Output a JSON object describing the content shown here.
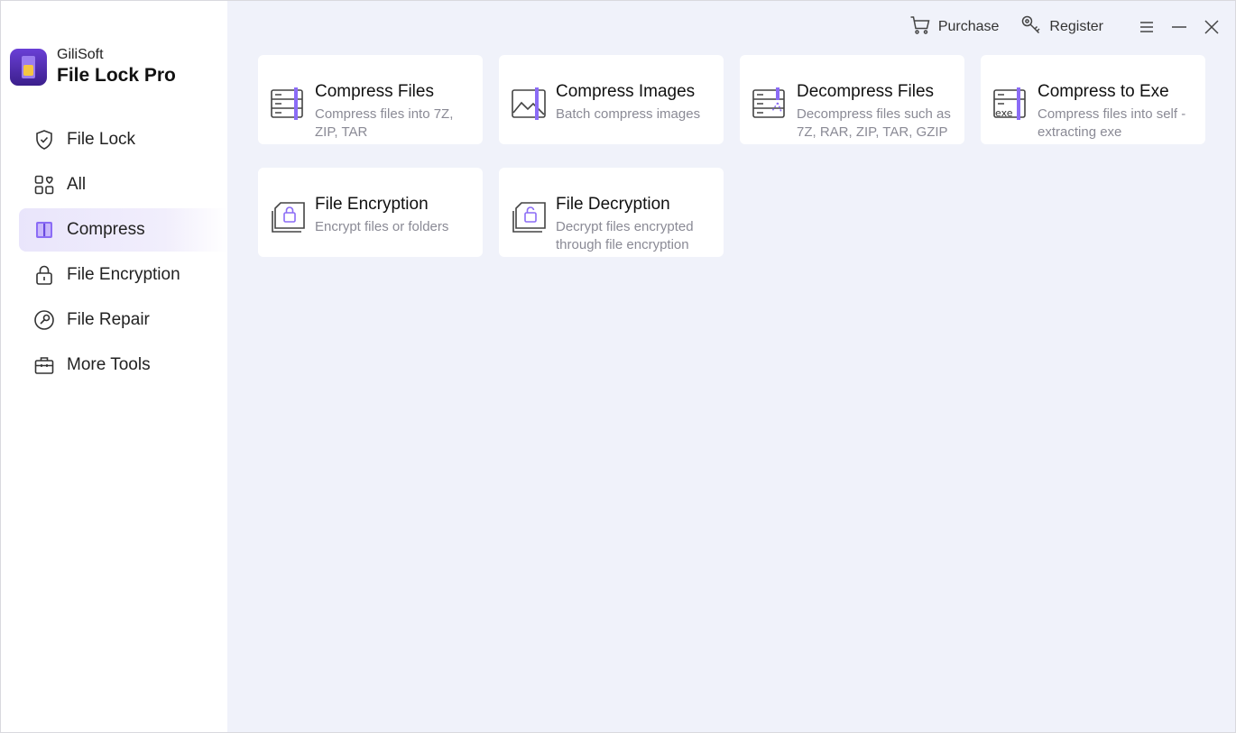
{
  "brand": {
    "company": "GiliSoft",
    "product": "File Lock Pro"
  },
  "sidebar": {
    "items": [
      {
        "label": "File Lock",
        "icon": "shield-check-icon",
        "active": false
      },
      {
        "label": "All",
        "icon": "grid-heart-icon",
        "active": false
      },
      {
        "label": "Compress",
        "icon": "zip-archive-icon",
        "active": true
      },
      {
        "label": "File Encryption",
        "icon": "padlock-icon",
        "active": false
      },
      {
        "label": "File Repair",
        "icon": "wrench-circle-icon",
        "active": false
      },
      {
        "label": "More Tools",
        "icon": "toolbox-icon",
        "active": false
      }
    ]
  },
  "topbar": {
    "purchase": "Purchase",
    "register": "Register"
  },
  "cards": [
    {
      "title": "Compress Files",
      "desc": "Compress files into 7Z, ZIP, TAR",
      "icon": "compress-files-icon"
    },
    {
      "title": "Compress Images",
      "desc": "Batch compress images",
      "icon": "compress-images-icon"
    },
    {
      "title": "Decompress Files",
      "desc": "Decompress files such as 7Z, RAR, ZIP, TAR, GZIP",
      "icon": "decompress-files-icon"
    },
    {
      "title": "Compress to Exe",
      "desc": "Compress files into self - extracting exe",
      "icon": "compress-exe-icon"
    },
    {
      "title": "File Encryption",
      "desc": "Encrypt files or folders",
      "icon": "file-lock-icon"
    },
    {
      "title": "File Decryption",
      "desc": "Decrypt files encrypted through file encryption",
      "icon": "file-unlock-icon"
    }
  ],
  "colors": {
    "accent": "#8b6cf6",
    "background": "#f0f2fa",
    "active_nav": "#e9e5fb"
  }
}
